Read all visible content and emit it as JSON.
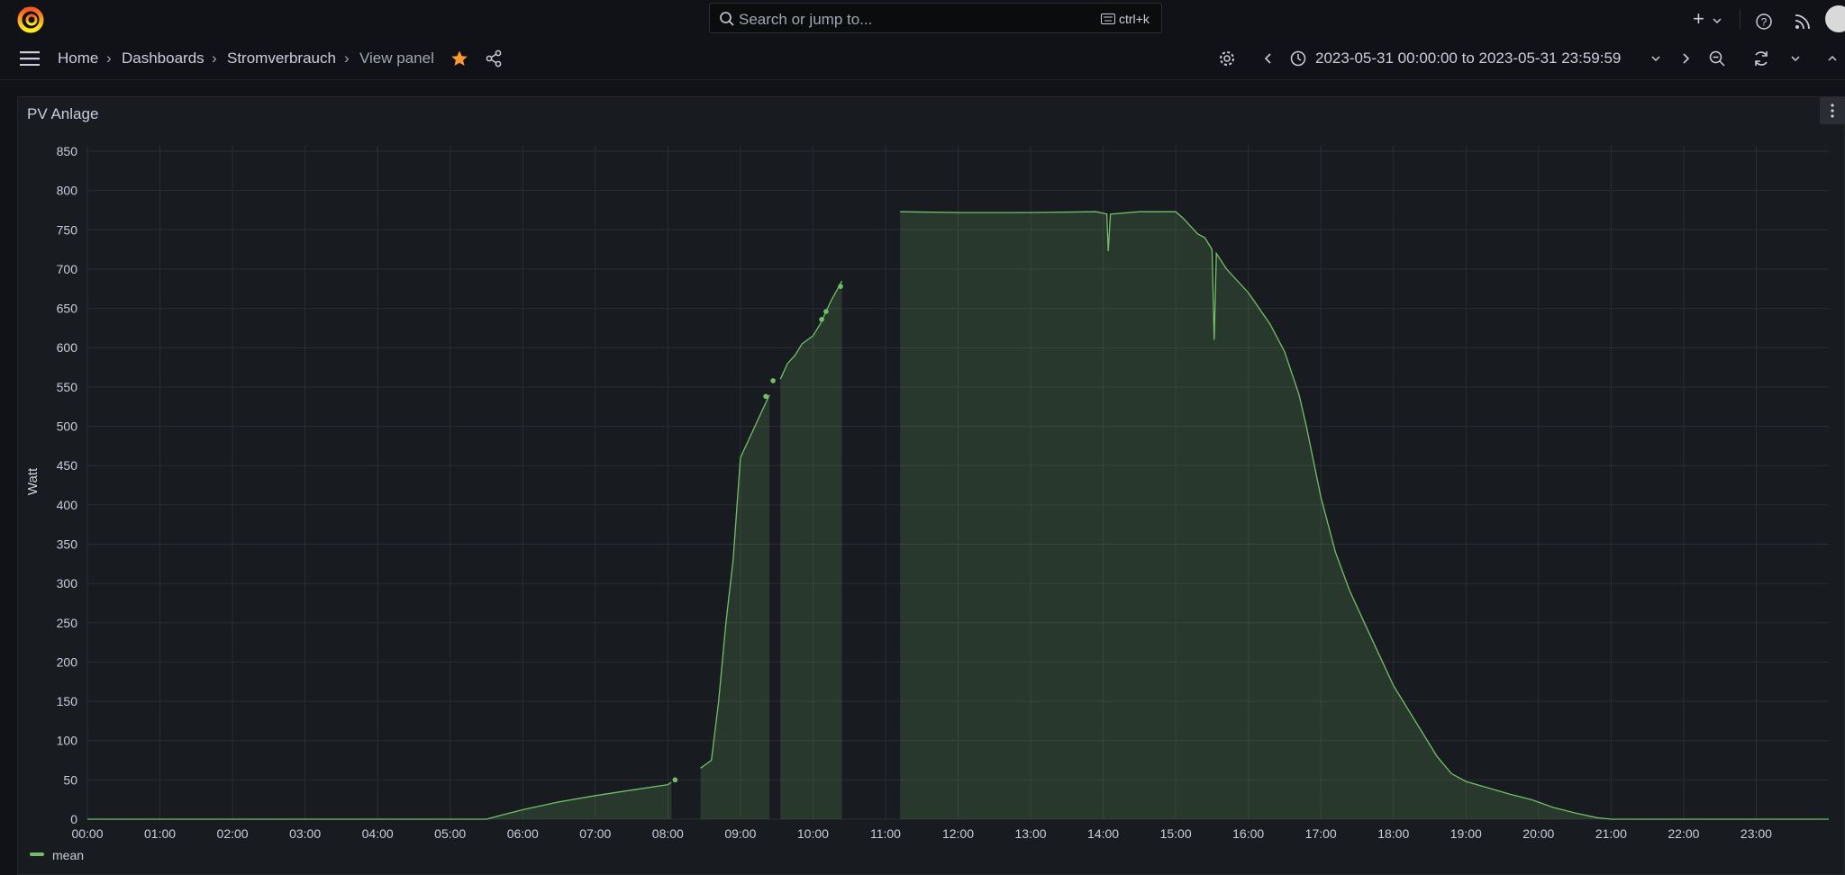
{
  "topbar": {
    "search_placeholder": "Search or jump to...",
    "search_shortcut": "ctrl+k",
    "plus_label": "+"
  },
  "breadcrumb": {
    "home": "Home",
    "dashboards": "Dashboards",
    "dashboard": "Stromverbrauch",
    "current": "View panel"
  },
  "time_range": {
    "from": "2023-05-31 00:00:00",
    "to_word": "to",
    "to": "2023-05-31 23:59:59"
  },
  "panel": {
    "title": "PV Anlage"
  },
  "colors": {
    "series": "#73bf69",
    "star": "#ff9830"
  },
  "chart_data": {
    "type": "area",
    "ylabel": "Watt",
    "ylim": [
      0,
      850
    ],
    "yticks": [
      0,
      50,
      100,
      150,
      200,
      250,
      300,
      350,
      400,
      450,
      500,
      550,
      600,
      650,
      700,
      750,
      800,
      850
    ],
    "xlim": [
      0,
      24
    ],
    "xticks": [
      "00:00",
      "01:00",
      "02:00",
      "03:00",
      "04:00",
      "05:00",
      "06:00",
      "07:00",
      "08:00",
      "09:00",
      "10:00",
      "11:00",
      "12:00",
      "13:00",
      "14:00",
      "15:00",
      "16:00",
      "17:00",
      "18:00",
      "19:00",
      "20:00",
      "21:00",
      "22:00",
      "23:00"
    ],
    "legend": "bottom-left",
    "series": [
      {
        "name": "mean",
        "segments": [
          [
            [
              0,
              0
            ],
            [
              5.5,
              0
            ],
            [
              5.7,
              5
            ],
            [
              6,
              12
            ],
            [
              6.5,
              22
            ],
            [
              7,
              30
            ],
            [
              7.5,
              37
            ],
            [
              8,
              44
            ],
            [
              8.05,
              47
            ]
          ],
          [
            [
              8.45,
              65
            ],
            [
              8.6,
              75
            ],
            [
              8.7,
              150
            ],
            [
              8.8,
              250
            ],
            [
              8.9,
              330
            ],
            [
              9.0,
              460
            ],
            [
              9.1,
              480
            ],
            [
              9.2,
              500
            ],
            [
              9.3,
              520
            ],
            [
              9.4,
              540
            ]
          ],
          [
            [
              9.55,
              560
            ],
            [
              9.65,
              580
            ],
            [
              9.75,
              590
            ],
            [
              9.85,
              605
            ],
            [
              10.0,
              615
            ],
            [
              10.1,
              630
            ],
            [
              10.25,
              660
            ],
            [
              10.4,
              685
            ]
          ],
          [
            [
              11.2,
              773
            ],
            [
              12,
              772
            ],
            [
              13,
              772
            ],
            [
              13.9,
              773
            ],
            [
              14.05,
              770
            ],
            [
              14.07,
              723
            ],
            [
              14.1,
              770
            ],
            [
              14.5,
              773
            ],
            [
              15,
              773
            ],
            [
              15.1,
              765
            ],
            [
              15.2,
              755
            ],
            [
              15.3,
              745
            ],
            [
              15.4,
              740
            ],
            [
              15.5,
              725
            ],
            [
              15.53,
              610
            ],
            [
              15.56,
              720
            ],
            [
              15.7,
              700
            ],
            [
              16,
              670
            ],
            [
              16.3,
              630
            ],
            [
              16.5,
              595
            ],
            [
              16.7,
              540
            ],
            [
              16.8,
              500
            ],
            [
              17,
              410
            ],
            [
              17.2,
              340
            ],
            [
              17.4,
              290
            ],
            [
              17.6,
              250
            ],
            [
              17.8,
              210
            ],
            [
              18,
              170
            ],
            [
              18.2,
              140
            ],
            [
              18.4,
              110
            ],
            [
              18.6,
              80
            ],
            [
              18.8,
              58
            ],
            [
              19,
              48
            ],
            [
              19.3,
              40
            ],
            [
              19.6,
              32
            ],
            [
              19.9,
              25
            ],
            [
              20.2,
              15
            ],
            [
              20.5,
              8
            ],
            [
              20.8,
              2
            ],
            [
              21,
              0
            ],
            [
              22,
              0
            ],
            [
              23,
              0
            ],
            [
              24,
              0
            ]
          ]
        ],
        "points": [
          [
            8.1,
            50
          ],
          [
            9.35,
            538
          ],
          [
            9.45,
            558
          ],
          [
            10.12,
            636
          ],
          [
            10.18,
            646
          ],
          [
            10.38,
            678
          ]
        ]
      }
    ]
  }
}
